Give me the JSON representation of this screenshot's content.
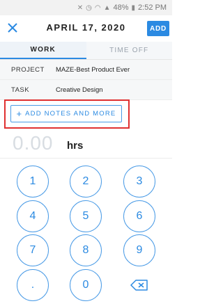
{
  "status_bar": {
    "battery": "48%",
    "time": "2:52 PM"
  },
  "header": {
    "title": "APRIL 17, 2020",
    "add_label": "ADD"
  },
  "tabs": [
    {
      "label": "WORK",
      "active": true
    },
    {
      "label": "TIME OFF",
      "active": false
    }
  ],
  "fields": {
    "project": {
      "label": "PROJECT",
      "value": "MAZE-Best Product Ever"
    },
    "task": {
      "label": "TASK",
      "value": "Creative Design"
    }
  },
  "notes_button": {
    "label": "ADD NOTES AND MORE"
  },
  "hours": {
    "value": "0.00",
    "unit": "hrs"
  },
  "keypad": {
    "keys": [
      "1",
      "2",
      "3",
      "4",
      "5",
      "6",
      "7",
      "8",
      "9",
      ".",
      "0"
    ],
    "backspace_icon": "backspace-icon"
  },
  "colors": {
    "accent": "#2b8ae2",
    "highlight": "#e03030"
  }
}
